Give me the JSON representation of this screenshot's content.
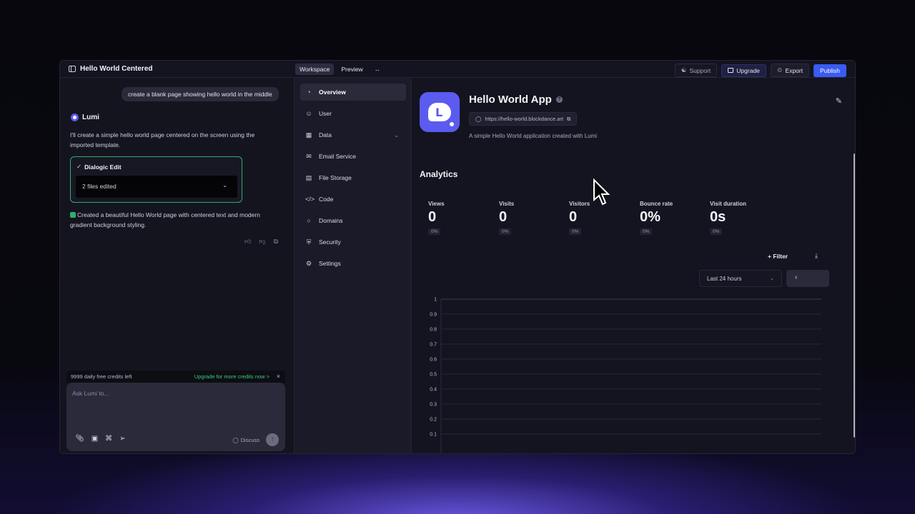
{
  "header": {
    "project_title": "Hello World Centered",
    "tabs": [
      "Workspace",
      "Preview"
    ],
    "support": "Support",
    "upgrade": "Upgrade",
    "export": "Export",
    "publish": "Publish"
  },
  "chat": {
    "user_message": "create a blank page showing hello world in the middle",
    "assistant_name": "Lumi",
    "assistant_text": "I'll create a simple hello world page centered on the screen using the imported template.",
    "dialog_title": "Dialogic Edit",
    "files_edited": "2 files edited",
    "done_text": "Created a beautiful Hello World page with centered text and modern gradient background styling.",
    "credits_left": "9999 daily free credits left",
    "upgrade_link": "Upgrade for more credits now >",
    "input_placeholder": "Ask Lumi to...",
    "discuss_label": "Discuss"
  },
  "nav": {
    "items": [
      {
        "label": "Overview",
        "icon": "pie-icon"
      },
      {
        "label": "User",
        "icon": "user-icon"
      },
      {
        "label": "Data",
        "icon": "table-icon"
      },
      {
        "label": "Email Service",
        "icon": "mail-icon"
      },
      {
        "label": "File Storage",
        "icon": "drive-icon"
      },
      {
        "label": "Code",
        "icon": "code-icon"
      },
      {
        "label": "Domains",
        "icon": "globe-icon"
      },
      {
        "label": "Security",
        "icon": "shield-icon"
      },
      {
        "label": "Settings",
        "icon": "gear-icon"
      }
    ]
  },
  "app": {
    "name": "Hello World App",
    "url": "https://hello-world.blockdance.art",
    "description": "A simple Hello World application created with Lumi"
  },
  "analytics": {
    "heading": "Analytics",
    "stats": [
      {
        "label": "Views",
        "value": "0",
        "change": "0%"
      },
      {
        "label": "Visits",
        "value": "0",
        "change": "0%"
      },
      {
        "label": "Visitors",
        "value": "0",
        "change": "0%"
      },
      {
        "label": "Bounce rate",
        "value": "0%",
        "change": "0%"
      },
      {
        "label": "Visit duration",
        "value": "0s",
        "change": "0%"
      }
    ],
    "filter_label": "Filter",
    "range_label": "Last 24 hours",
    "pager_prev": "‹"
  },
  "chart_data": {
    "type": "line",
    "y_ticks": [
      "1",
      "0.9",
      "0.8",
      "0.7",
      "0.6",
      "0.5",
      "0.4",
      "0.3",
      "0.2",
      "0.1"
    ],
    "ylim": [
      0,
      1
    ],
    "grid": true,
    "series": []
  },
  "colors": {
    "accent": "#3a5cf5",
    "brand": "#5b5bf0",
    "success": "#2fae6c"
  }
}
